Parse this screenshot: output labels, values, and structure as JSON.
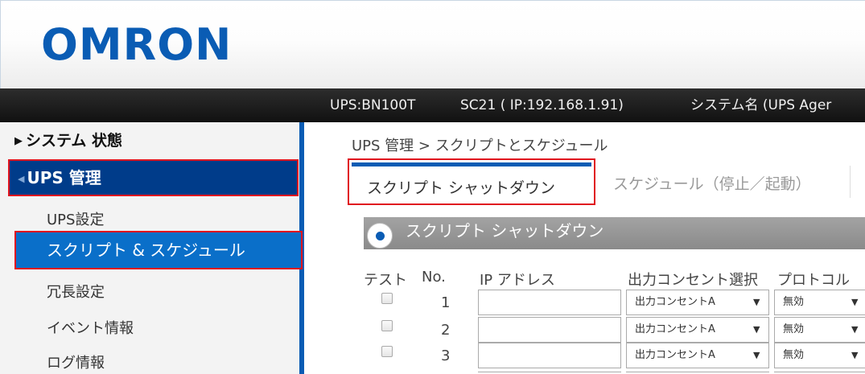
{
  "header": {
    "logo_text": "OMRON",
    "brand_color": "#0a5cb4"
  },
  "status_bar": {
    "ups_model": "UPS:BN100T",
    "card": "SC21 ( IP:192.168.1.91)",
    "system_name": "システム名 (UPS Ager"
  },
  "sidebar": {
    "system_state": "システム 状態",
    "ups_management": "UPS 管理",
    "items": [
      {
        "label": "UPS設定"
      },
      {
        "label": "スクリプト & スケジュール"
      },
      {
        "label": "冗長設定"
      },
      {
        "label": "イベント情報"
      },
      {
        "label": "ログ情報"
      }
    ]
  },
  "main": {
    "breadcrumb": "UPS 管理 > スクリプトとスケジュール",
    "tabs": [
      {
        "label": "スクリプト シャットダウン"
      },
      {
        "label": "スケジュール（停止／起動）"
      }
    ],
    "section_title": "スクリプト シャットダウン",
    "table": {
      "headers": [
        "テスト",
        "No.",
        "IP アドレス",
        "出力コンセント選択",
        "プロトコル"
      ],
      "rows": [
        {
          "no": "1",
          "ip": "",
          "outlet": "出力コンセントA",
          "protocol": "無効"
        },
        {
          "no": "2",
          "ip": "",
          "outlet": "出力コンセントA",
          "protocol": "無効"
        },
        {
          "no": "3",
          "ip": "",
          "outlet": "出力コンセントA",
          "protocol": "無効"
        }
      ],
      "dropdown_glyph": "▼"
    }
  },
  "colors": {
    "active_blue": "#0a6fc9",
    "highlight_red": "#e0151f",
    "nav_dark_blue": "#003c8a"
  }
}
